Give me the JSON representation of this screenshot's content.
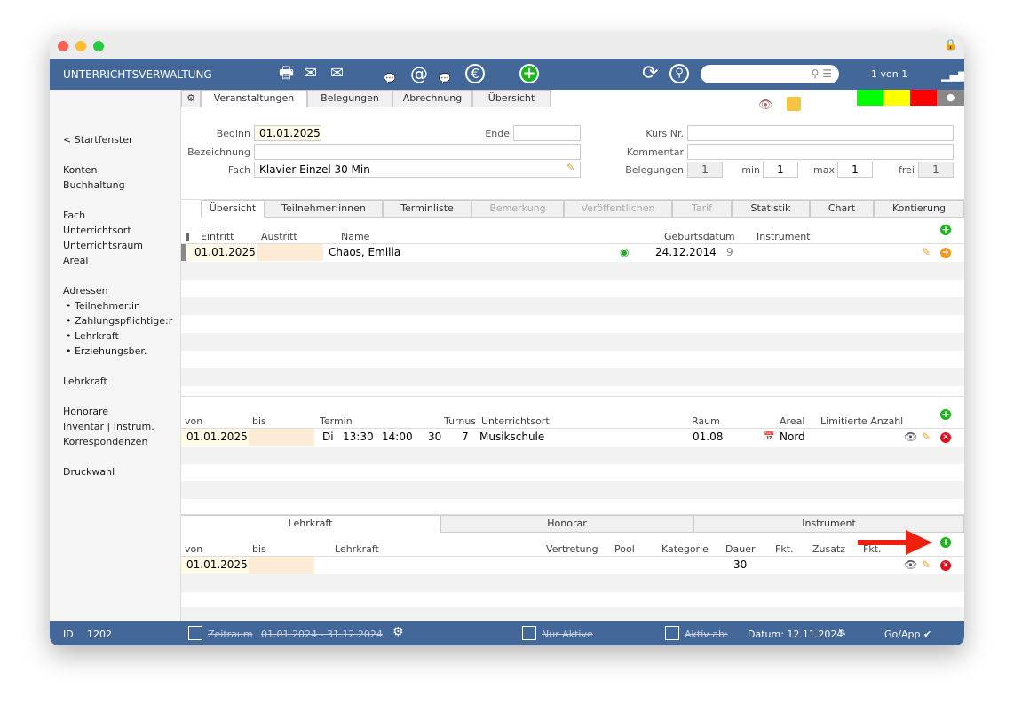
{
  "header": {
    "title": "UNTERRICHTSVERWALTUNG",
    "record_counter": "1 von 1",
    "search_placeholder": ""
  },
  "status_colors": [
    "#00ff00",
    "#ffff00",
    "#ff0000",
    "#888888"
  ],
  "sidebar": {
    "items": [
      "< Startfenster",
      "Konten",
      "Buchhaltung",
      "Fach",
      "Unterrichtsort",
      "Unterrichtsraum",
      "Areal",
      "Adressen",
      "• Teilnehmer:in",
      "• Zahlungspflichtige:r",
      "• Lehrkraft",
      "• Erziehungsber.",
      "Lehrkraft",
      "Honorare",
      "Inventar | Instrum.",
      "Korrespondenzen",
      "Druckwahl"
    ]
  },
  "main_tabs": [
    "Veranstaltungen",
    "Belegungen",
    "Abrechnung",
    "Übersicht"
  ],
  "form": {
    "beginn_label": "Beginn",
    "beginn": "01.01.2025",
    "ende_label": "Ende",
    "ende": "",
    "bezeichnung_label": "Bezeichnung",
    "bezeichnung": "",
    "fach_label": "Fach",
    "fach": "Klavier Einzel 30 Min",
    "kursnr_label": "Kurs Nr.",
    "kursnr": "",
    "kommentar_label": "Kommentar",
    "kommentar": "",
    "belegungen_label": "Belegungen",
    "belegungen": "1",
    "min_label": "min",
    "min": "1",
    "max_label": "max",
    "max": "1",
    "frei_label": "frei",
    "frei": "1"
  },
  "sub_tabs": [
    "Übersicht",
    "Teilnehmer:innen",
    "Terminliste",
    "Bemerkung",
    "Veröffentlichen",
    "Tarif",
    "Statistik",
    "Chart",
    "Kontierung"
  ],
  "participants": {
    "headers": [
      "Eintritt",
      "Austritt",
      "Name",
      "Geburtsdatum",
      "Instrument"
    ],
    "rows": [
      {
        "eintritt": "01.01.2025",
        "austritt": "",
        "name": "Chaos, Emilia",
        "geburtsdatum": "24.12.2014",
        "alter": "9",
        "instrument": ""
      }
    ]
  },
  "schedule": {
    "headers": [
      "von",
      "bis",
      "Termin",
      "Turnus",
      "Unterrichtsort",
      "Raum",
      "Areal",
      "Limitierte Anzahl"
    ],
    "rows": [
      {
        "von": "01.01.2025",
        "bis": "",
        "tag": "Di",
        "start": "13:30",
        "ende": "14:00",
        "dauer": "30",
        "turnus": "7",
        "ort": "Musikschule",
        "raum": "01.08",
        "areal": "Nord"
      }
    ]
  },
  "bottom_tabs": [
    "Lehrkraft",
    "Honorar",
    "Instrument"
  ],
  "teacher": {
    "headers": [
      "von",
      "bis",
      "Lehrkraft",
      "Vertretung",
      "Pool",
      "Kategorie",
      "Dauer",
      "Fkt.",
      "Zusatz",
      "Fkt."
    ],
    "rows": [
      {
        "von": "01.01.2025",
        "bis": "",
        "dauer": "30"
      }
    ]
  },
  "footer": {
    "id_label": "ID",
    "id": "1202",
    "zeitraum_label": "Zeitraum",
    "zeitraum": "01.01.2024 - 31.12.2024",
    "nur_aktive": "Nur Aktive",
    "aktiv_ab": "Aktiv ab:",
    "datum": "Datum: 12.11.2024",
    "goapp": "Go/App ✔"
  }
}
